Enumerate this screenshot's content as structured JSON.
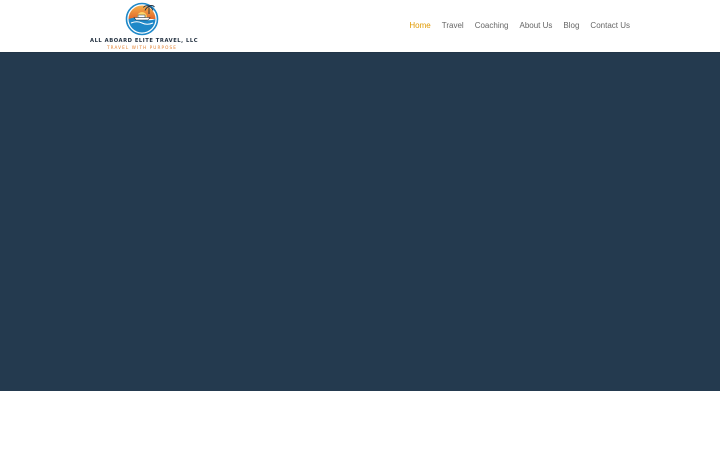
{
  "brand": {
    "name": "ALL ABOARD ELITE TRAVEL, LLC",
    "tagline": "TRAVEL WITH PURPOSE",
    "emblem_icon": "sunset-cruise-logo-icon",
    "colors": {
      "navy": "#1f2d3d",
      "orange": "#e27d2a",
      "sea": "#1e88c8"
    }
  },
  "nav": {
    "items": [
      {
        "label": "Home",
        "active": true
      },
      {
        "label": "Travel",
        "active": false
      },
      {
        "label": "Coaching",
        "active": false
      },
      {
        "label": "About Us",
        "active": false
      },
      {
        "label": "Blog",
        "active": false
      },
      {
        "label": "Contact Us",
        "active": false
      }
    ],
    "active_color": "#e09900",
    "text_color": "#666666"
  },
  "hero": {
    "background": "#243a4f"
  }
}
